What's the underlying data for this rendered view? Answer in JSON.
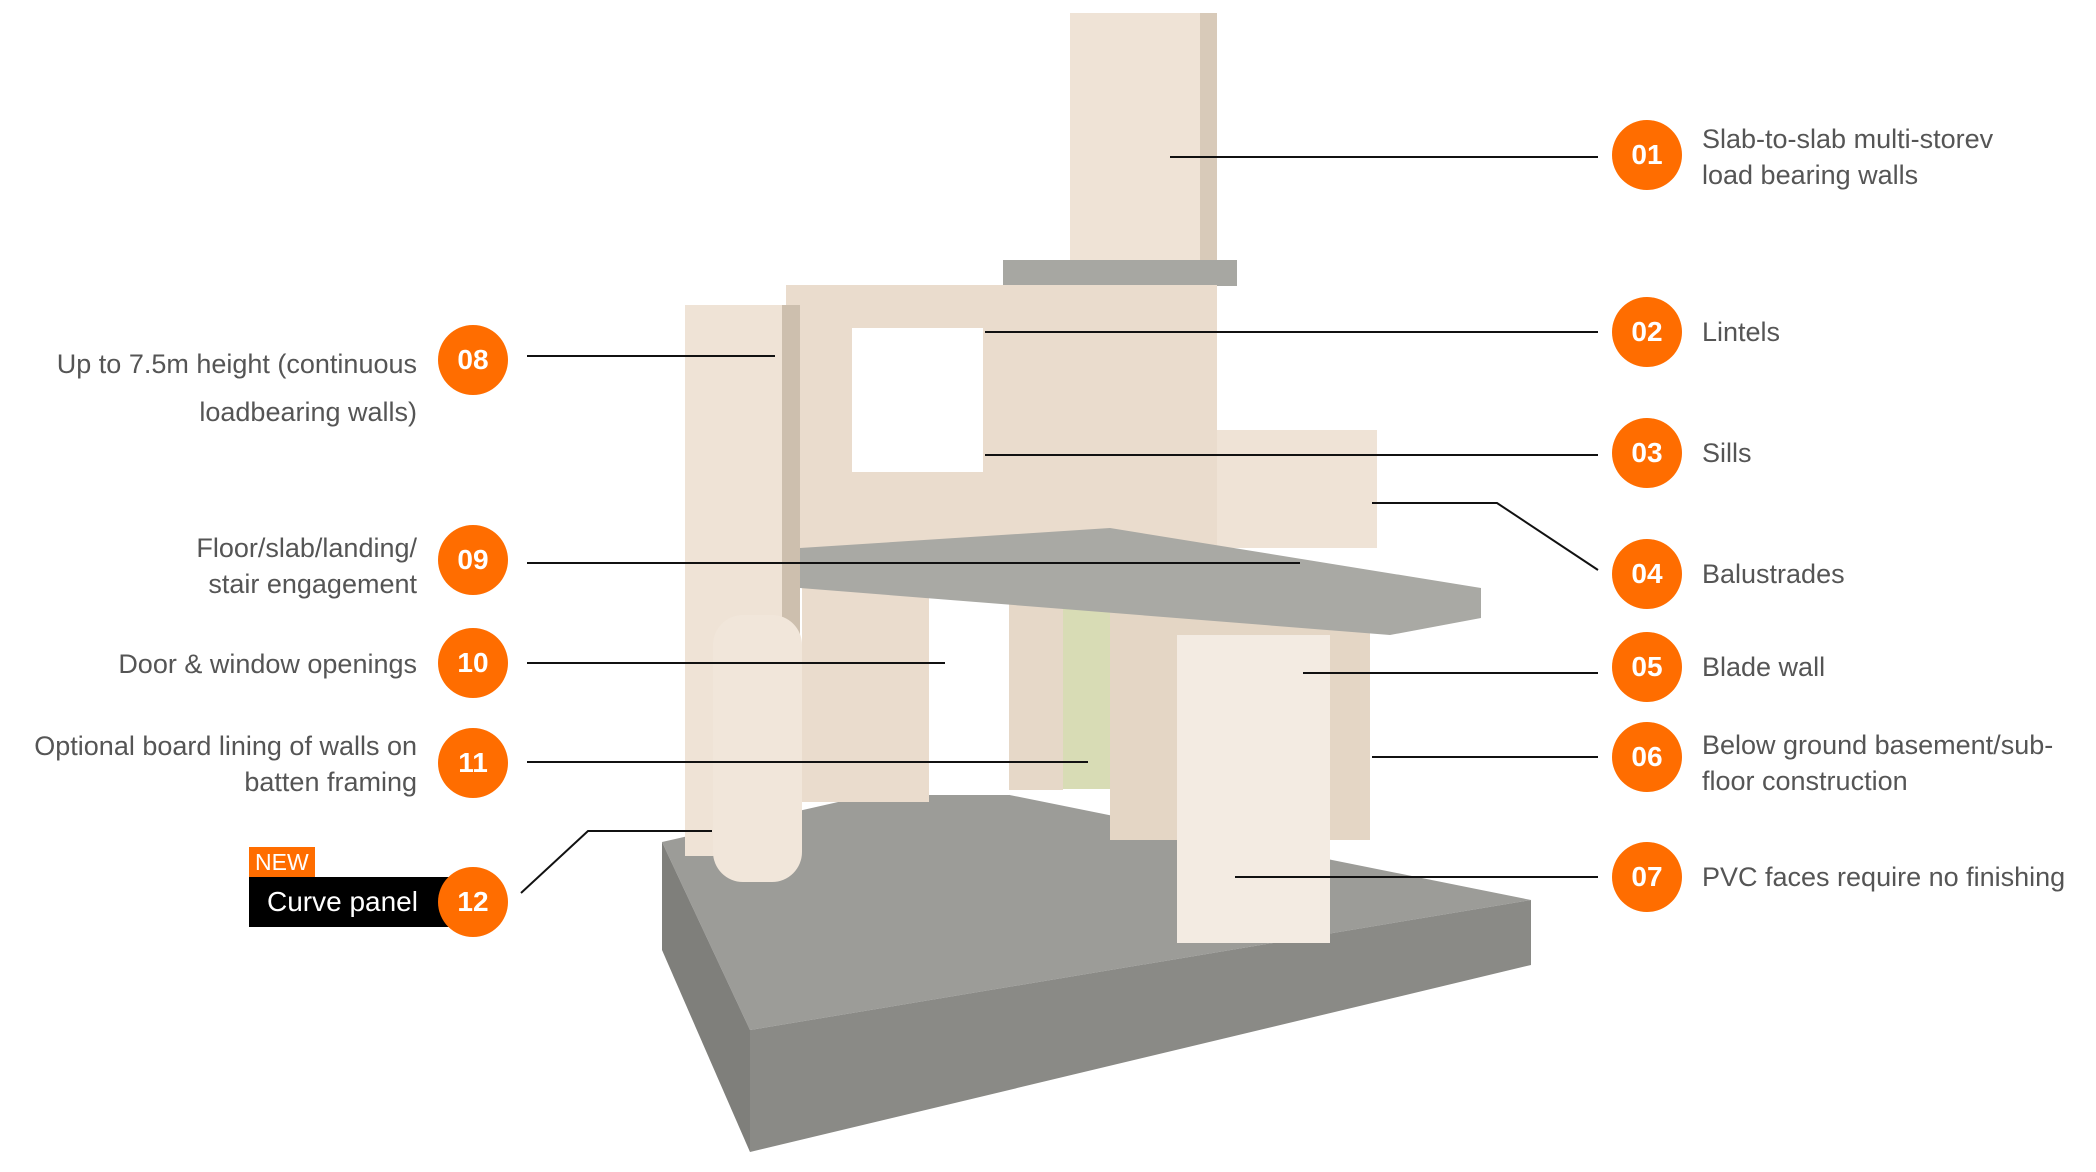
{
  "accent_color": "#ff6d00",
  "callouts": [
    {
      "num": "01",
      "text": "Slab-to-slab multi-storev load bearing walls"
    },
    {
      "num": "02",
      "text": "Lintels"
    },
    {
      "num": "03",
      "text": "Sills"
    },
    {
      "num": "04",
      "text": "Balustrades"
    },
    {
      "num": "05",
      "text": "Blade wall"
    },
    {
      "num": "06",
      "text": "Below ground basement/sub-floor construction"
    },
    {
      "num": "07",
      "text": "PVC faces require no finishing"
    },
    {
      "num": "08",
      "text": "Up to 7.5m height (continuous loadbearing walls)"
    },
    {
      "num": "09",
      "text": "Floor/slab/landing/ stair engagement"
    },
    {
      "num": "10",
      "text": "Door & window openings"
    },
    {
      "num": "11",
      "text": "Optional board lining of walls on batten framing"
    },
    {
      "num": "12",
      "text": "Curve panel",
      "tag": "NEW"
    }
  ]
}
